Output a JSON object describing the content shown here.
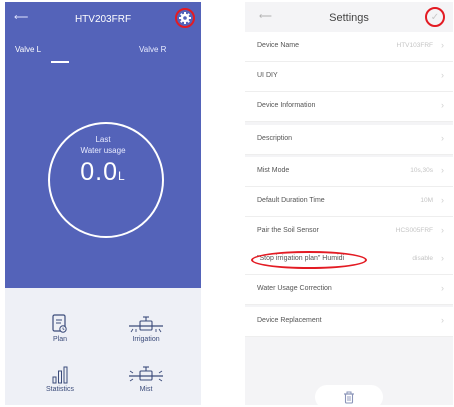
{
  "left_screen": {
    "title": "HTV203FRF",
    "back_icon": "back-arrow-icon",
    "settings_icon": "gear-icon",
    "tabs": [
      {
        "label": "Valve L",
        "active": true
      },
      {
        "label": "Valve R",
        "active": false
      }
    ],
    "gauge": {
      "label_line1": "Last",
      "label_line2": "Water usage",
      "value": "0.0",
      "unit": "L"
    },
    "bottom_nav": [
      {
        "label": "Plan",
        "icon": "plan-icon"
      },
      {
        "label": "Irrigation",
        "icon": "irrigation-icon"
      },
      {
        "label": "Statistics",
        "icon": "statistics-icon"
      },
      {
        "label": "Mist",
        "icon": "mist-icon"
      }
    ]
  },
  "right_screen": {
    "title": "Settings",
    "back_icon": "back-arrow-icon",
    "confirm_icon": "check-icon",
    "rows": [
      {
        "label": "Device Name",
        "value": "HTV103FRF"
      },
      {
        "label": "UI DIY",
        "value": ""
      },
      {
        "label": "Device Information",
        "value": ""
      },
      {
        "label": "Description",
        "value": ""
      },
      {
        "label": "Mist Mode",
        "value": "10s,30s"
      },
      {
        "label": "Default Duration Time",
        "value": "10M"
      },
      {
        "label": "Pair the Soil Sensor",
        "value": "HCS005FRF"
      },
      {
        "label": "\"Stop irrigation plan\" Humidi",
        "value": "disable"
      },
      {
        "label": "Water Usage Correction",
        "value": ""
      },
      {
        "label": "Device Replacement",
        "value": ""
      }
    ],
    "delete_icon": "trash-icon"
  },
  "colors": {
    "header_blue": "#5463b9",
    "highlight_red": "#e31b23",
    "bottom_panel": "#eef0f6",
    "settings_bg": "#f4f4f6"
  }
}
